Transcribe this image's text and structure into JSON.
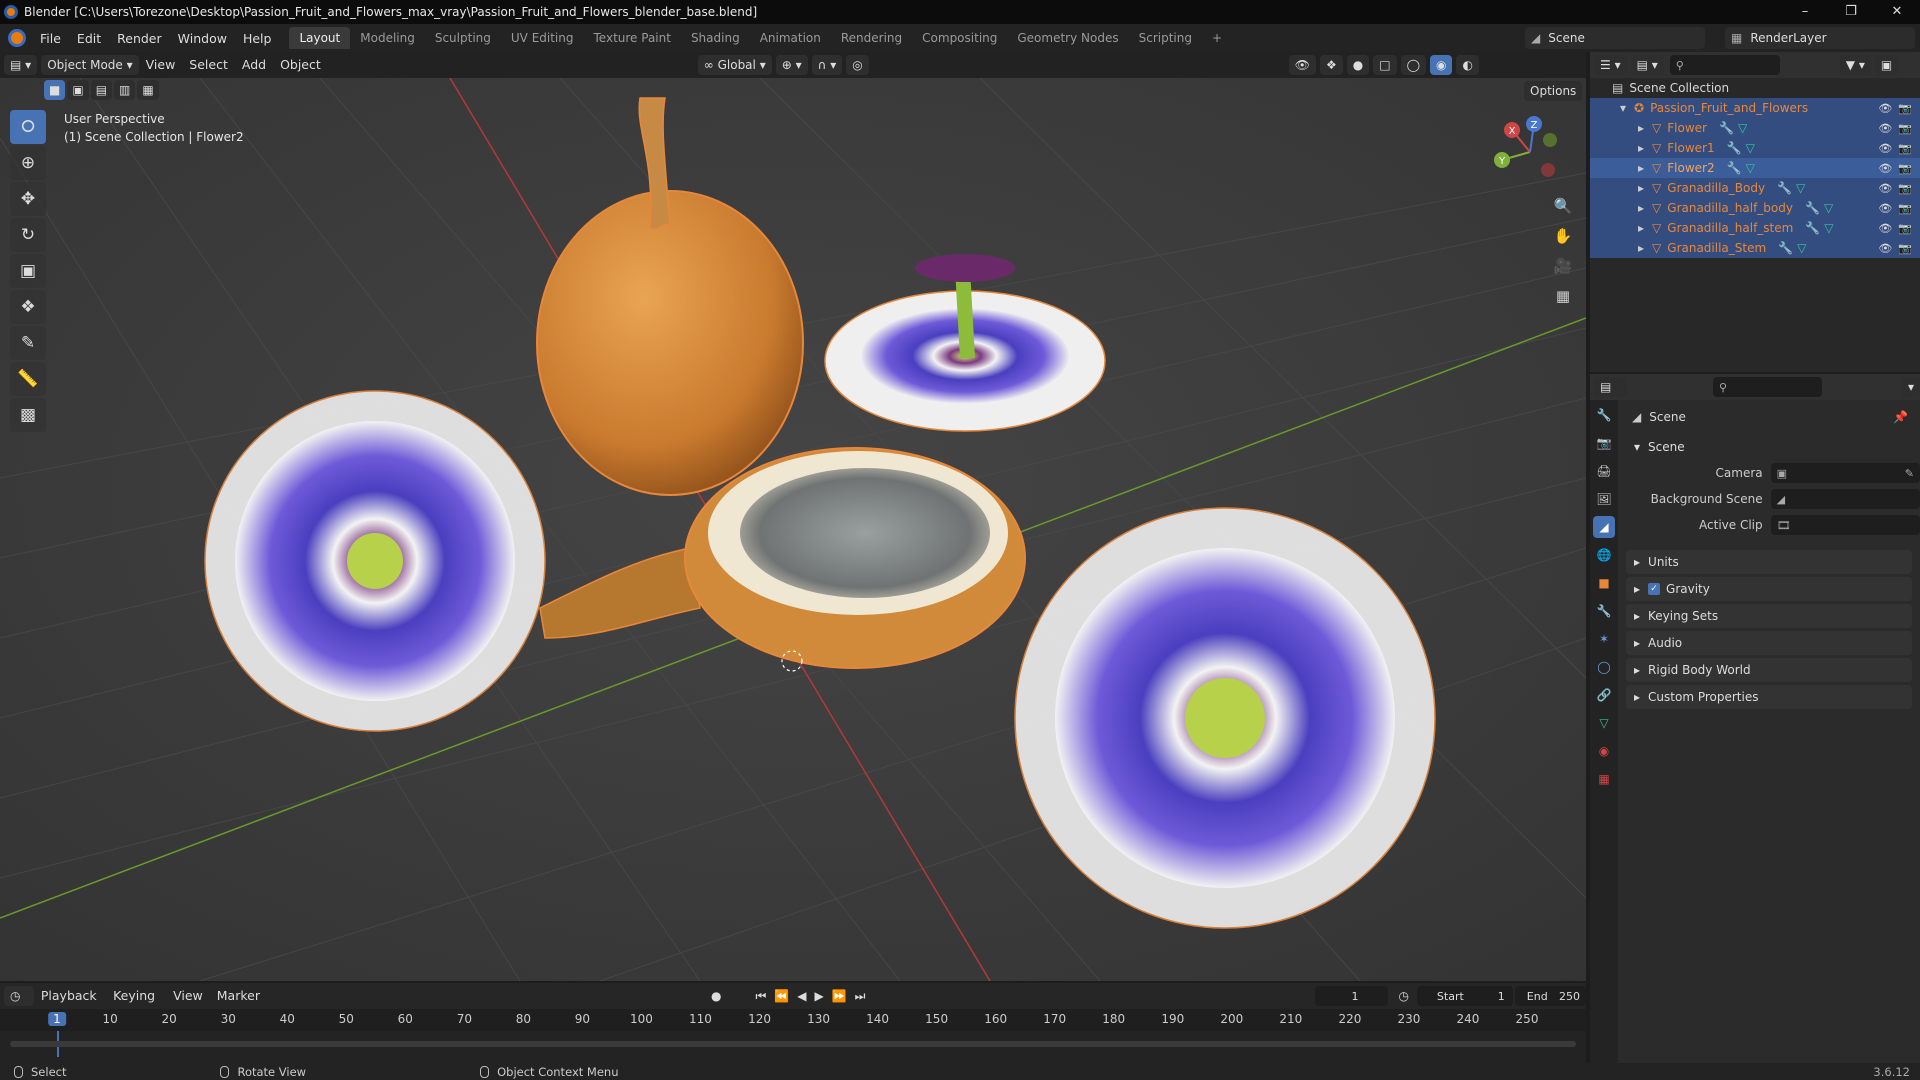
{
  "window": {
    "title": "Blender [C:\\Users\\Torezone\\Desktop\\Passion_Fruit_and_Flowers_max_vray\\Passion_Fruit_and_Flowers_blender_base.blend]",
    "controls": [
      "–",
      "❐",
      "✕"
    ]
  },
  "menu": {
    "items": [
      "File",
      "Edit",
      "Render",
      "Window",
      "Help"
    ],
    "workspaces": [
      "Layout",
      "Modeling",
      "Sculpting",
      "UV Editing",
      "Texture Paint",
      "Shading",
      "Animation",
      "Rendering",
      "Compositing",
      "Geometry Nodes",
      "Scripting",
      "+"
    ],
    "active_workspace": "Layout",
    "scene": "Scene",
    "view_layer": "RenderLayer"
  },
  "viewport_header": {
    "mode": "Object Mode",
    "menus": [
      "View",
      "Select",
      "Add",
      "Object"
    ],
    "orientation": "Global",
    "options": "Options"
  },
  "viewport": {
    "info_line1": "User Perspective",
    "info_line2": "(1) Scene Collection | Flower2",
    "gizmo": {
      "x": "X",
      "y": "Y",
      "z": "Z"
    }
  },
  "outliner": {
    "root": "Scene Collection",
    "collection": "Passion_Fruit_and_Flowers",
    "objects": [
      {
        "name": "Flower",
        "selected": false
      },
      {
        "name": "Flower1",
        "selected": false
      },
      {
        "name": "Flower2",
        "selected": true
      },
      {
        "name": "Granadilla_Body",
        "selected": false
      },
      {
        "name": "Granadilla_half_body",
        "selected": false
      },
      {
        "name": "Granadilla_half_stem",
        "selected": false
      },
      {
        "name": "Granadilla_Stem",
        "selected": false
      }
    ]
  },
  "properties": {
    "context": "Scene",
    "section_scene": "Scene",
    "fields": [
      {
        "label": "Camera",
        "value": ""
      },
      {
        "label": "Background Scene",
        "value": ""
      },
      {
        "label": "Active Clip",
        "value": ""
      }
    ],
    "panels": [
      "Units",
      "Gravity",
      "Keying Sets",
      "Audio",
      "Rigid Body World",
      "Custom Properties"
    ],
    "gravity_checked": true
  },
  "timeline": {
    "menus": [
      "Playback",
      "Keying",
      "View",
      "Marker"
    ],
    "current_frame": "1",
    "start_label": "Start",
    "start": "1",
    "end_label": "End",
    "end": "250",
    "ticks": [
      "1",
      "10",
      "20",
      "30",
      "40",
      "50",
      "60",
      "70",
      "80",
      "90",
      "100",
      "110",
      "120",
      "130",
      "140",
      "150",
      "160",
      "170",
      "180",
      "190",
      "200",
      "210",
      "220",
      "230",
      "240",
      "250"
    ]
  },
  "statusbar": {
    "select": "Select",
    "rotate": "Rotate View",
    "context_menu": "Object Context Menu",
    "version": "3.6.12"
  },
  "colors": {
    "accent_blue": "#4772b3",
    "selection_orange": "#e8873a",
    "grid_bg": "#3d3d3d",
    "x_axis": "#b43838",
    "y_axis": "#6a9a2a"
  }
}
